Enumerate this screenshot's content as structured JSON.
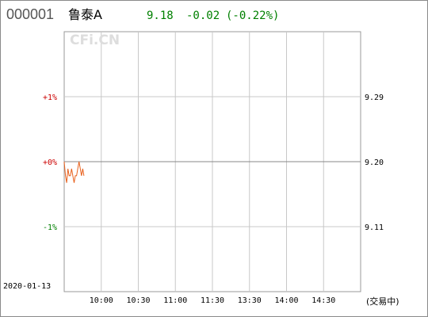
{
  "header": {
    "code": "000001",
    "name": "鲁泰A",
    "price": "9.18",
    "change": "-0.02",
    "change_pct": "(-0.22%)"
  },
  "watermark": "CFi.CN",
  "date": "2020-01-13",
  "status": "(交易中)",
  "colors": {
    "up": "#cc0000",
    "down": "#008000",
    "neutral": "#000000",
    "line": "#e8601c",
    "grid": "#c8c8c8",
    "zero": "#888888"
  },
  "chart_data": {
    "type": "line",
    "title": "",
    "xlabel": "",
    "ylabel": "",
    "x_ticks": [
      "10:00",
      "10:30",
      "11:00",
      "11:30",
      "13:30",
      "14:00",
      "14:30"
    ],
    "left_ticks": [
      "+1%",
      "+0%",
      "-1%"
    ],
    "right_ticks": [
      "9.29",
      "9.20",
      "9.11"
    ],
    "ylim_pct": [
      -2,
      2
    ],
    "pre_close": 9.2,
    "series": [
      {
        "x": [
          "09:30",
          "09:31",
          "09:32",
          "09:33",
          "09:34",
          "09:35",
          "09:36",
          "09:37",
          "09:38",
          "09:39",
          "09:40",
          "09:41",
          "09:42",
          "09:43",
          "09:44",
          "09:45",
          "09:46"
        ],
        "y": [
          9.2,
          9.18,
          9.17,
          9.19,
          9.18,
          9.18,
          9.19,
          9.18,
          9.17,
          9.18,
          9.18,
          9.19,
          9.2,
          9.19,
          9.18,
          9.19,
          9.18
        ]
      }
    ]
  }
}
